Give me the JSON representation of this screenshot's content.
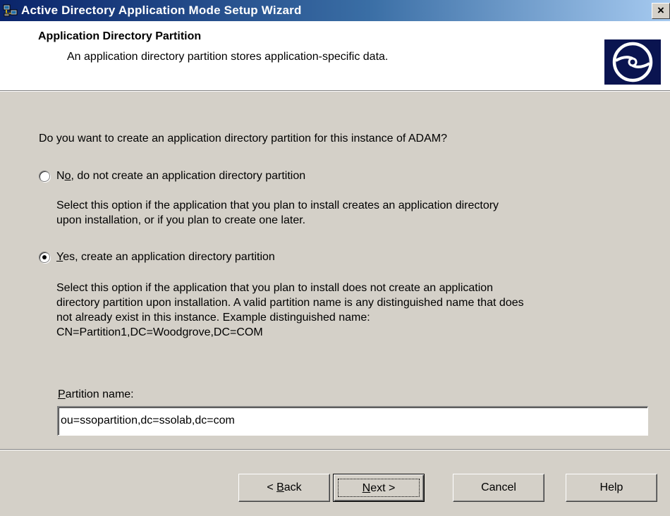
{
  "window": {
    "title": "Active Directory Application Mode Setup Wizard",
    "close_label": "×"
  },
  "header": {
    "title": "Application Directory Partition",
    "subtitle": "An application directory partition stores application-specific data.",
    "logo_icon": "disc-icon"
  },
  "question": "Do you want to create an application directory partition for this instance of ADAM?",
  "options": [
    {
      "label_pre": "N",
      "label_mnemonic": "o",
      "label_post": ", do not create an application directory partition",
      "selected": false,
      "description_lines": [
        "Select this option if the application that you plan to install creates an application directory",
        "upon installation, or if you plan to create one later."
      ]
    },
    {
      "label_pre": "",
      "label_mnemonic": "Y",
      "label_post": "es, create an application directory partition",
      "selected": true,
      "description_lines": [
        "Select this option if the application that you plan to install does not create an application",
        "directory partition upon installation. A valid partition name is any distinguished name that does",
        "not already exist in this instance. Example distinguished name:",
        "CN=Partition1,DC=Woodgrove,DC=COM"
      ]
    }
  ],
  "partition": {
    "label_mnemonic": "P",
    "label_rest": "artition name:",
    "value": "ou=ssopartition,dc=ssolab,dc=com"
  },
  "buttons": {
    "back_prefix": "< ",
    "back_mnemonic": "B",
    "back_rest": "ack",
    "next_mnemonic": "N",
    "next_rest": "ext >",
    "cancel": "Cancel",
    "help": "Help"
  },
  "colors": {
    "title_bar_start": "#0a246a",
    "title_bar_end": "#a6caf0",
    "dialog_face": "#d4d0c8",
    "logo_bg": "#0a1450"
  }
}
